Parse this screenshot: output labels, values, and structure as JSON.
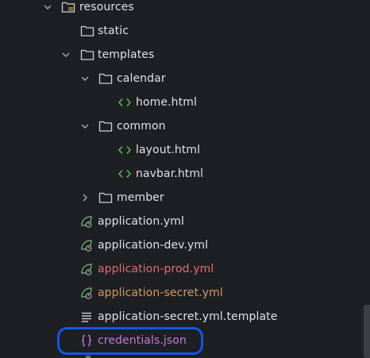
{
  "project_tree": {
    "items": [
      {
        "label": "resources",
        "kind": "folder-resources",
        "expanded": true,
        "text_color": "#dfe1e5"
      },
      {
        "label": "static",
        "kind": "folder",
        "expanded": false,
        "text_color": "#dfe1e5"
      },
      {
        "label": "templates",
        "kind": "folder",
        "expanded": true,
        "text_color": "#dfe1e5"
      },
      {
        "label": "calendar",
        "kind": "folder",
        "expanded": true,
        "text_color": "#dfe1e5"
      },
      {
        "label": "home.html",
        "kind": "html-file",
        "text_color": "#dfe1e5"
      },
      {
        "label": "common",
        "kind": "folder",
        "expanded": true,
        "text_color": "#dfe1e5"
      },
      {
        "label": "layout.html",
        "kind": "html-file",
        "text_color": "#dfe1e5"
      },
      {
        "label": "navbar.html",
        "kind": "html-file",
        "text_color": "#dfe1e5"
      },
      {
        "label": "member",
        "kind": "folder",
        "expanded": false,
        "text_color": "#dfe1e5"
      },
      {
        "label": "application.yml",
        "kind": "spring-config-file",
        "text_color": "#dfe1e5"
      },
      {
        "label": "application-dev.yml",
        "kind": "spring-config-file",
        "text_color": "#dfe1e5"
      },
      {
        "label": "application-prod.yml",
        "kind": "spring-config-file",
        "text_color": "#e06c75"
      },
      {
        "label": "application-secret.yml",
        "kind": "spring-config-file",
        "text_color": "#d19a66"
      },
      {
        "label": "application-secret.yml.template",
        "kind": "text-file",
        "text_color": "#dfe1e5"
      },
      {
        "label": "credentials.json",
        "kind": "json-file",
        "text_color": "#c678dd"
      }
    ]
  },
  "colors": {
    "background": "#1e1f22",
    "text_default": "#dfe1e5",
    "folder_icon": "#cfd1d6",
    "chevron": "#a8abb0",
    "html_icon_green": "#5fb865",
    "spring_leaf_green": "#6aab73",
    "json_icon_purple": "#c678dd",
    "highlight_blue": "#1455e6"
  }
}
